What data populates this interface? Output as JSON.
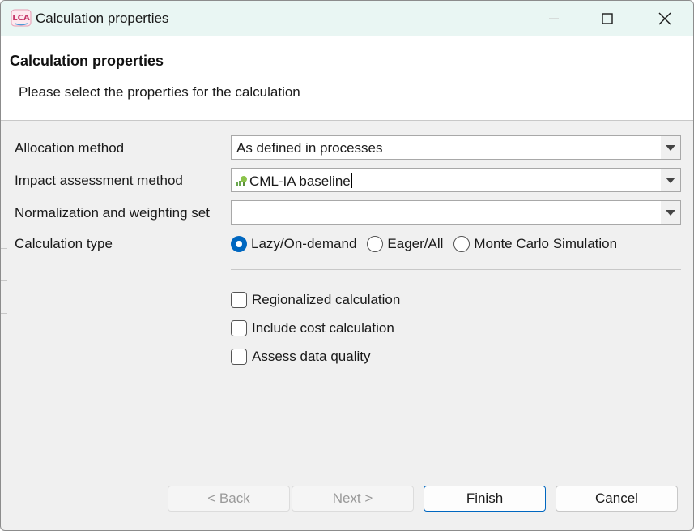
{
  "window": {
    "title": "Calculation properties",
    "app_icon_text": "LCA"
  },
  "header": {
    "title": "Calculation properties",
    "description": "Please select the properties for the calculation"
  },
  "form": {
    "allocation": {
      "label": "Allocation method",
      "value": "As defined in processes"
    },
    "impact": {
      "label": "Impact assessment method",
      "value": "CML-IA baseline",
      "icon": "impact-method-icon"
    },
    "normalization": {
      "label": "Normalization and weighting set",
      "value": ""
    },
    "calc_type": {
      "label": "Calculation type",
      "options": [
        "Lazy/On-demand",
        "Eager/All",
        "Monte Carlo Simulation"
      ],
      "selected": "Lazy/On-demand"
    },
    "checkboxes": [
      {
        "label": "Regionalized calculation",
        "checked": false
      },
      {
        "label": "Include cost calculation",
        "checked": false
      },
      {
        "label": "Assess data quality",
        "checked": false
      }
    ]
  },
  "buttons": {
    "back": "< Back",
    "next": "Next >",
    "finish": "Finish",
    "cancel": "Cancel"
  },
  "colors": {
    "accent": "#0067c0",
    "titlebar": "#e9f6f3"
  }
}
